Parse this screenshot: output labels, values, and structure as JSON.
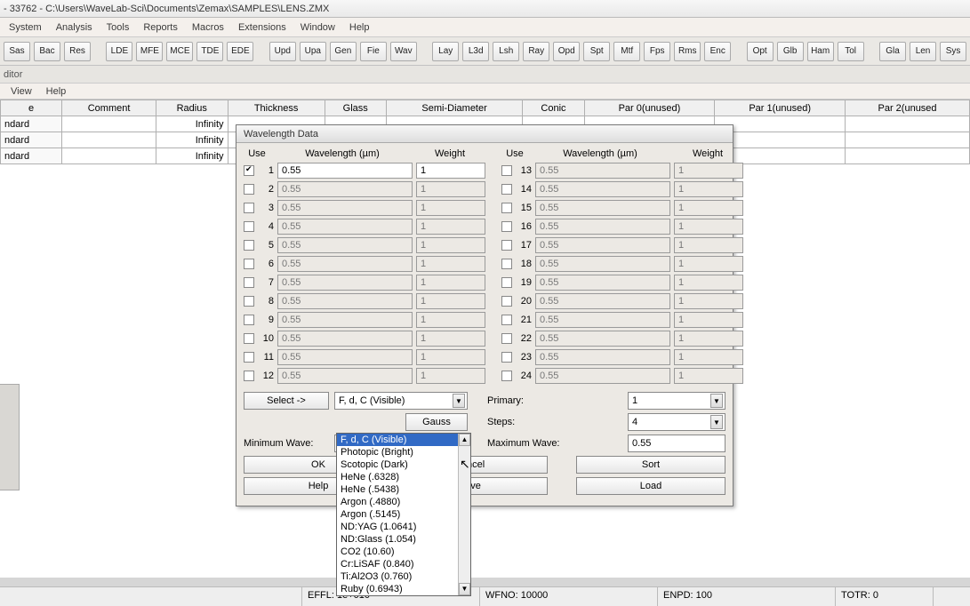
{
  "title": "- 33762 - C:\\Users\\WaveLab-Sci\\Documents\\Zemax\\SAMPLES\\LENS.ZMX",
  "menu": [
    "System",
    "Analysis",
    "Tools",
    "Reports",
    "Macros",
    "Extensions",
    "Window",
    "Help"
  ],
  "toolbar_groups": [
    [
      "Sas",
      "Bac",
      "Res"
    ],
    [
      "LDE",
      "MFE",
      "MCE",
      "TDE",
      "EDE"
    ],
    [
      "Upd",
      "Upa",
      "Gen",
      "Fie",
      "Wav"
    ],
    [
      "Lay",
      "L3d",
      "Lsh",
      "Ray",
      "Opd",
      "Spt",
      "Mtf",
      "Fps",
      "Rms",
      "Enc"
    ],
    [
      "Opt",
      "Glb",
      "Ham",
      "Tol"
    ],
    [
      "Gla",
      "Len",
      "Sys"
    ]
  ],
  "editor_label": "ditor",
  "editor_menu": [
    "View",
    "Help"
  ],
  "columns": [
    "e",
    "Comment",
    "Radius",
    "Thickness",
    "Glass",
    "Semi-Diameter",
    "Conic",
    "Par 0(unused)",
    "Par 1(unused)",
    "Par 2(unused"
  ],
  "rows": [
    {
      "type": "ndard",
      "radius": "Infinity"
    },
    {
      "type": "ndard",
      "radius": "Infinity"
    },
    {
      "type": "ndard",
      "radius": "Infinity"
    }
  ],
  "dialog": {
    "title": "Wavelength Data",
    "headers": {
      "use": "Use",
      "wl": "Wavelength (µm)",
      "wt": "Weight"
    },
    "left": [
      {
        "n": "1",
        "ck": true,
        "wl": "0.55",
        "wt": "1"
      },
      {
        "n": "2",
        "ck": false,
        "wl": "0.55",
        "wt": "1"
      },
      {
        "n": "3",
        "ck": false,
        "wl": "0.55",
        "wt": "1"
      },
      {
        "n": "4",
        "ck": false,
        "wl": "0.55",
        "wt": "1"
      },
      {
        "n": "5",
        "ck": false,
        "wl": "0.55",
        "wt": "1"
      },
      {
        "n": "6",
        "ck": false,
        "wl": "0.55",
        "wt": "1"
      },
      {
        "n": "7",
        "ck": false,
        "wl": "0.55",
        "wt": "1"
      },
      {
        "n": "8",
        "ck": false,
        "wl": "0.55",
        "wt": "1"
      },
      {
        "n": "9",
        "ck": false,
        "wl": "0.55",
        "wt": "1"
      },
      {
        "n": "10",
        "ck": false,
        "wl": "0.55",
        "wt": "1"
      },
      {
        "n": "11",
        "ck": false,
        "wl": "0.55",
        "wt": "1"
      },
      {
        "n": "12",
        "ck": false,
        "wl": "0.55",
        "wt": "1"
      }
    ],
    "right": [
      {
        "n": "13",
        "ck": false,
        "wl": "0.55",
        "wt": "1"
      },
      {
        "n": "14",
        "ck": false,
        "wl": "0.55",
        "wt": "1"
      },
      {
        "n": "15",
        "ck": false,
        "wl": "0.55",
        "wt": "1"
      },
      {
        "n": "16",
        "ck": false,
        "wl": "0.55",
        "wt": "1"
      },
      {
        "n": "17",
        "ck": false,
        "wl": "0.55",
        "wt": "1"
      },
      {
        "n": "18",
        "ck": false,
        "wl": "0.55",
        "wt": "1"
      },
      {
        "n": "19",
        "ck": false,
        "wl": "0.55",
        "wt": "1"
      },
      {
        "n": "20",
        "ck": false,
        "wl": "0.55",
        "wt": "1"
      },
      {
        "n": "21",
        "ck": false,
        "wl": "0.55",
        "wt": "1"
      },
      {
        "n": "22",
        "ck": false,
        "wl": "0.55",
        "wt": "1"
      },
      {
        "n": "23",
        "ck": false,
        "wl": "0.55",
        "wt": "1"
      },
      {
        "n": "24",
        "ck": false,
        "wl": "0.55",
        "wt": "1"
      }
    ],
    "select_btn": "Select ->",
    "preset_value": "F, d, C (Visible)",
    "gauss_btn": "Gauss",
    "primary_label": "Primary:",
    "primary_value": "1",
    "steps_label": "Steps:",
    "steps_value": "4",
    "min_label": "Minimum Wave:",
    "max_label": "Maximum Wave:",
    "max_value": "0.55",
    "ok": "OK",
    "cancel": "ancel",
    "help": "Help",
    "save": "ave",
    "sort": "Sort",
    "load": "Load",
    "options": [
      "F, d, C (Visible)",
      "Photopic (Bright)",
      "Scotopic (Dark)",
      "HeNe (.6328)",
      "HeNe (.5438)",
      "Argon (.4880)",
      "Argon (.5145)",
      "ND:YAG (1.0641)",
      "ND:Glass (1.054)",
      "CO2 (10.60)",
      "Cr:LiSAF (0.840)",
      "Ti:Al2O3 (0.760)",
      "Ruby (0.6943)"
    ]
  },
  "status": {
    "effl": "EFFL: 1e+010",
    "wfno": "WFNO: 10000",
    "enpd": "ENPD: 100",
    "totr": "TOTR: 0"
  }
}
